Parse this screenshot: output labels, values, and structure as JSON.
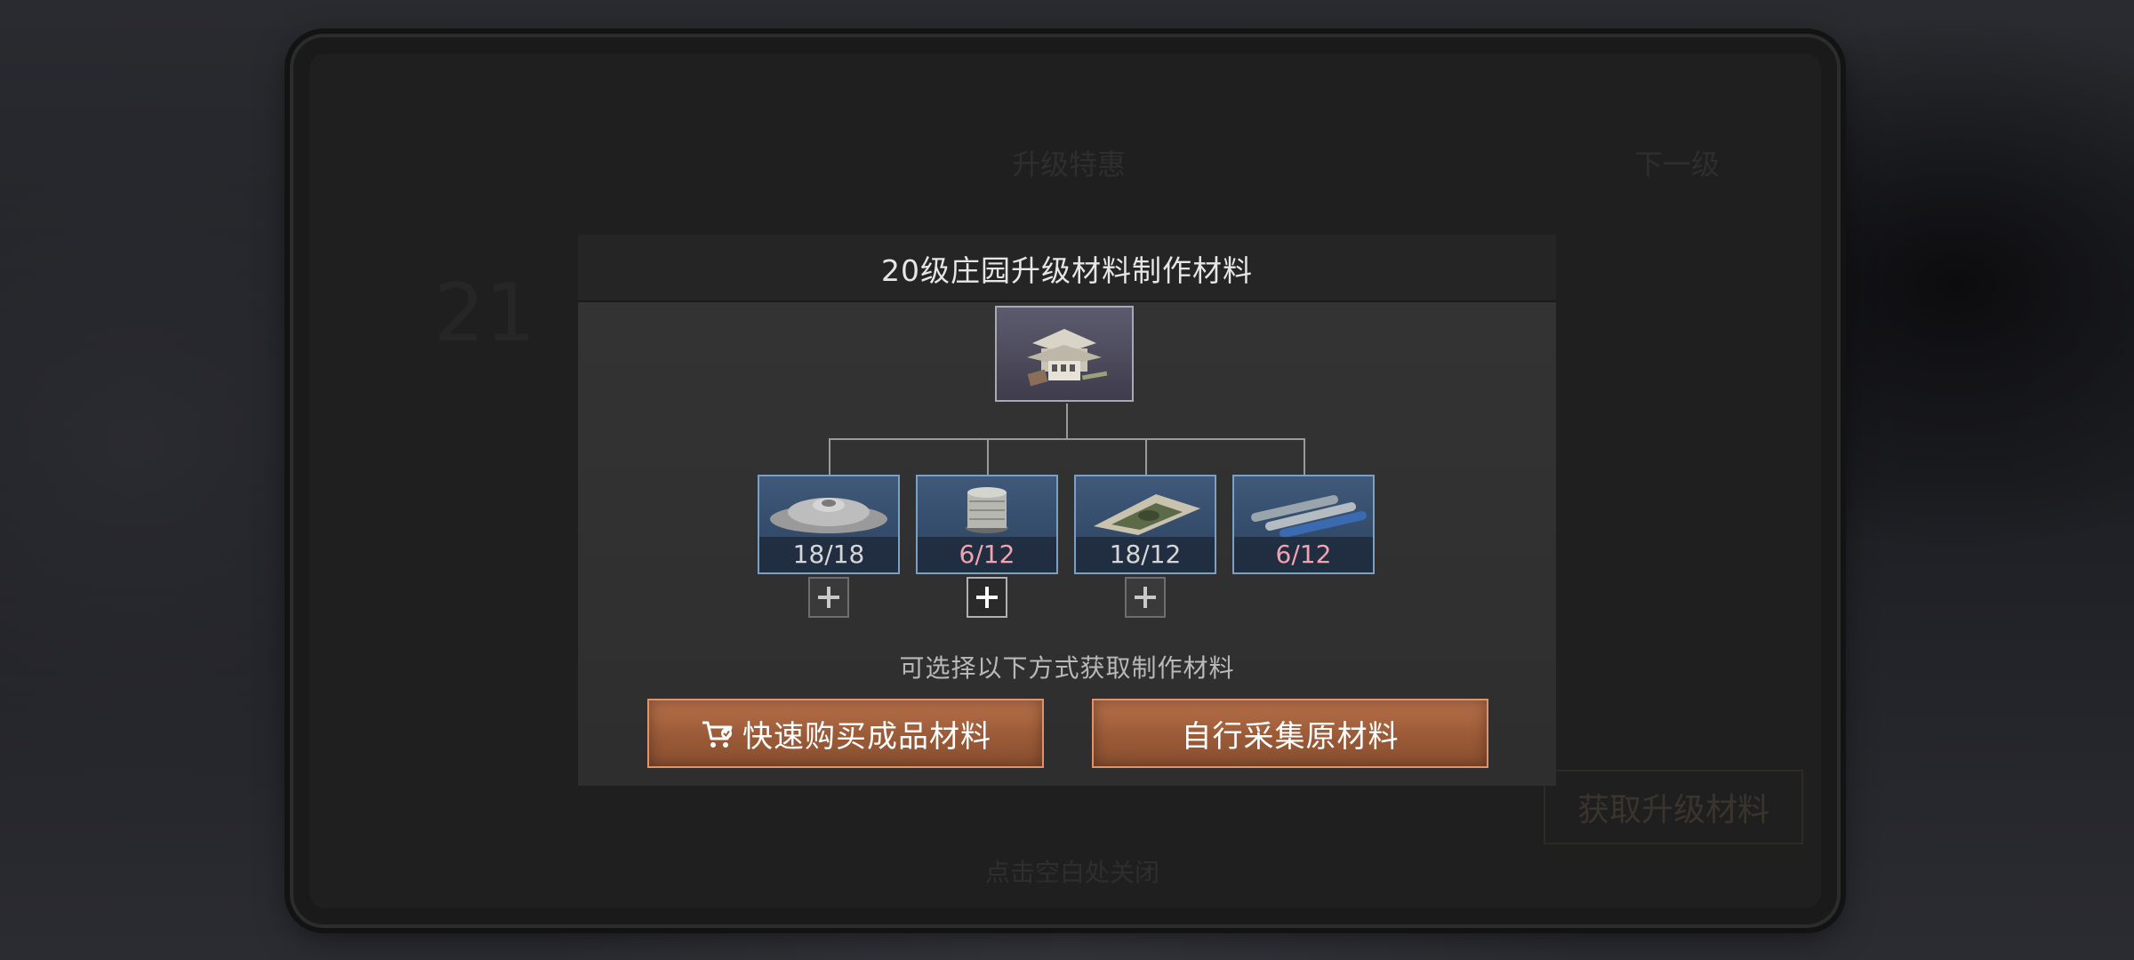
{
  "dialog": {
    "title": "20级庄园升级材料制作材料",
    "target_icon": "manor-building-icon",
    "materials": [
      {
        "icon": "ore-pile-icon",
        "count": "18/18",
        "count_color": "#d6d6d6",
        "has_plus": true
      },
      {
        "icon": "wire-spool-icon",
        "count": "6/12",
        "count_color": "#f2a3b0",
        "has_plus": true
      },
      {
        "icon": "fabric-sheet-icon",
        "count": "18/12",
        "count_color": "#d6d6d6",
        "has_plus": true
      },
      {
        "icon": "steel-pipes-icon",
        "count": "6/12",
        "count_color": "#f2a3b0",
        "has_plus": false
      }
    ],
    "hint": "可选择以下方式获取制作材料",
    "buy_button": {
      "label": "快速购买成品材料",
      "icon": "cart-icon"
    },
    "gather_button": {
      "label": "自行采集原材料"
    }
  },
  "background": {
    "top_title": "升级特惠",
    "next_level": "下一级",
    "level_number": "21",
    "bottom_hint": "点击空白处关闭",
    "side_button": "获取升级材料"
  },
  "colors": {
    "accent_orange": "#b8714a",
    "material_frame": "#7aa0c4",
    "insufficient": "#f2a3b0"
  }
}
